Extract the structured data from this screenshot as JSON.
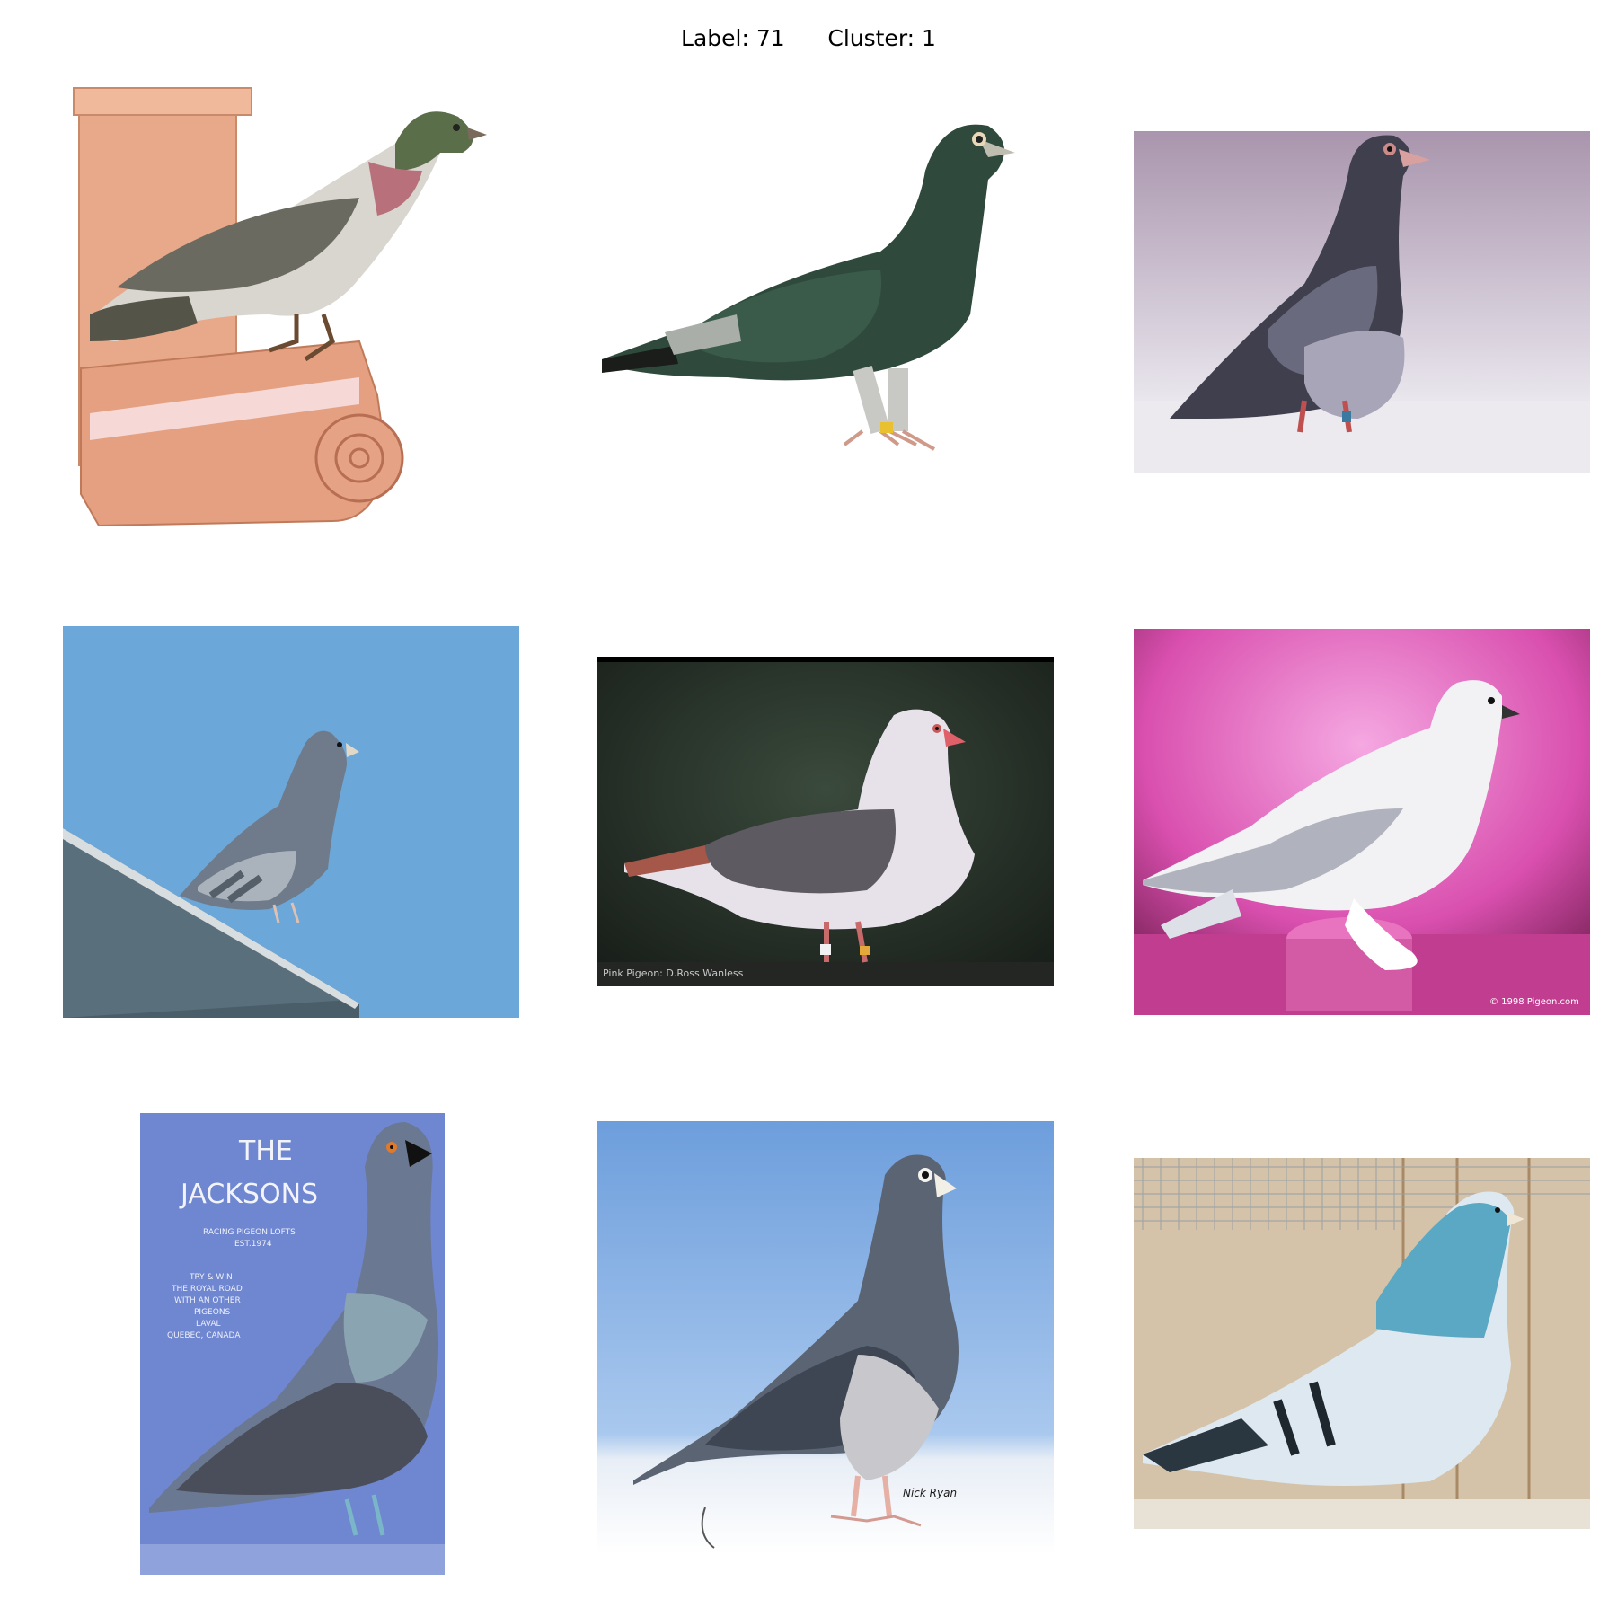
{
  "figure": {
    "label_text": "Label: 71",
    "cluster_text": "Cluster: 1"
  },
  "images": [
    {
      "subject": "pigeon illustration perched on a stone column ledge",
      "background": "white"
    },
    {
      "subject": "dark green checkered racing pigeon standing",
      "background": "white"
    },
    {
      "subject": "dark checkered pigeon standing",
      "background": "lavender grey"
    },
    {
      "subject": "blue bar pigeon on a rooftop edge",
      "background": "sky blue"
    },
    {
      "subject": "pink-headed pigeon with dark wing standing",
      "background": "dark green",
      "caption": "Pink Pigeon: D.Ross Wanless"
    },
    {
      "subject": "white feather-footed pigeon on a pedestal",
      "background": "magenta",
      "caption": "© 1998 Pigeon.com"
    },
    {
      "subject": "painted pigeon on a book cover",
      "background": "blue",
      "cover_title": [
        "THE",
        "JACKSONS"
      ],
      "cover_lines": [
        "RACING PIGEON LOFTS",
        "EST.1974",
        "TRY & WIN",
        "THE ROYAL ROAD",
        "WITH AN OTHER",
        "PIGEONS",
        "LAVAL",
        "QUEBEC, CANADA"
      ]
    },
    {
      "subject": "blue checkered racing pigeon standing",
      "background": "blue studio",
      "caption": "Nick Ryan"
    },
    {
      "subject": "light blue pigeon in a wooden loft behind wire mesh",
      "background": "wood"
    }
  ],
  "colors": {
    "bg": "#ffffff",
    "text": "#000000",
    "sky": "#6ba7d8",
    "magenta": "#d94fae",
    "lavender": "#8b7c94"
  }
}
